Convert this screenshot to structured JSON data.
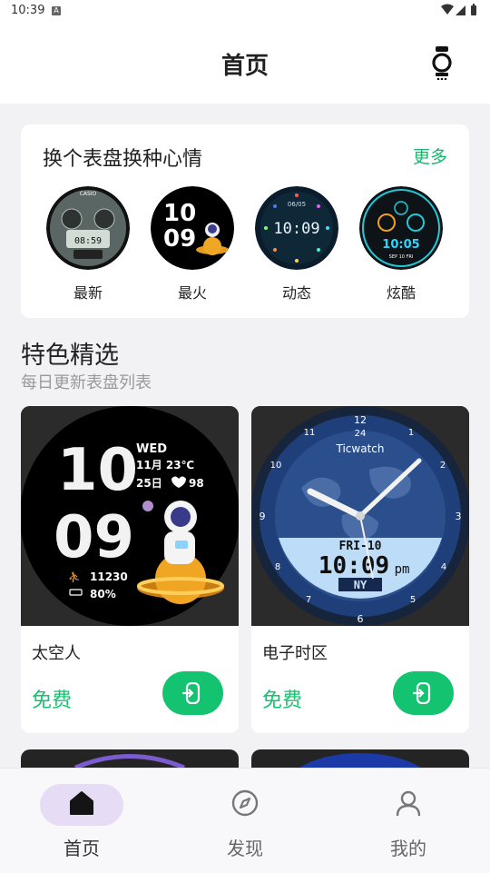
{
  "status_bar": {
    "time": "10:39",
    "notification_badge": "A"
  },
  "header": {
    "title": "首页",
    "watch_icon": "watch-icon"
  },
  "featured_strip": {
    "title": "换个表盘换种心情",
    "more_label": "更多",
    "faces": [
      {
        "label": "最新",
        "preview_time": "08:59",
        "brand": "CASIO"
      },
      {
        "label": "最火",
        "hour": "10",
        "minute": "09"
      },
      {
        "label": "动态",
        "preview_time": "10:09",
        "date": "06/05"
      },
      {
        "label": "炫酷",
        "preview_time": "10:05",
        "date": "SEP 10 FRI"
      }
    ]
  },
  "section": {
    "title": "特色精选",
    "subtitle": "每日更新表盘列表"
  },
  "products": [
    {
      "name": "太空人",
      "price": "免费",
      "install_icon": "watch-install-icon",
      "face": {
        "hour": "10",
        "minute": "09",
        "weekday": "WED",
        "date_line": "11月 23℃",
        "day_line": "25日",
        "heart": "98",
        "steps": "11230",
        "battery": "80%"
      }
    },
    {
      "name": "电子时区",
      "price": "免费",
      "install_icon": "watch-install-icon",
      "face": {
        "brand": "Ticwatch",
        "day": "FRI-10",
        "time": "10:09",
        "ampm": "pm",
        "zone": "NY",
        "bezel_numbers": [
          "12",
          "1",
          "2",
          "3",
          "4",
          "5",
          "6",
          "7",
          "8",
          "9",
          "10",
          "11"
        ],
        "bezel_24h": [
          "24",
          "2",
          "4",
          "6",
          "8",
          "10",
          "14",
          "16",
          "18",
          "20",
          "22"
        ]
      }
    }
  ],
  "bottom_nav": [
    {
      "label": "首页",
      "icon": "home-icon",
      "active": true
    },
    {
      "label": "发现",
      "icon": "compass-icon",
      "active": false
    },
    {
      "label": "我的",
      "icon": "profile-icon",
      "active": false
    }
  ],
  "colors": {
    "accent_green": "#14c36f",
    "more_green": "#14b86b",
    "nav_active_pill": "#e7dcf5",
    "background": "#f2f2f4"
  }
}
